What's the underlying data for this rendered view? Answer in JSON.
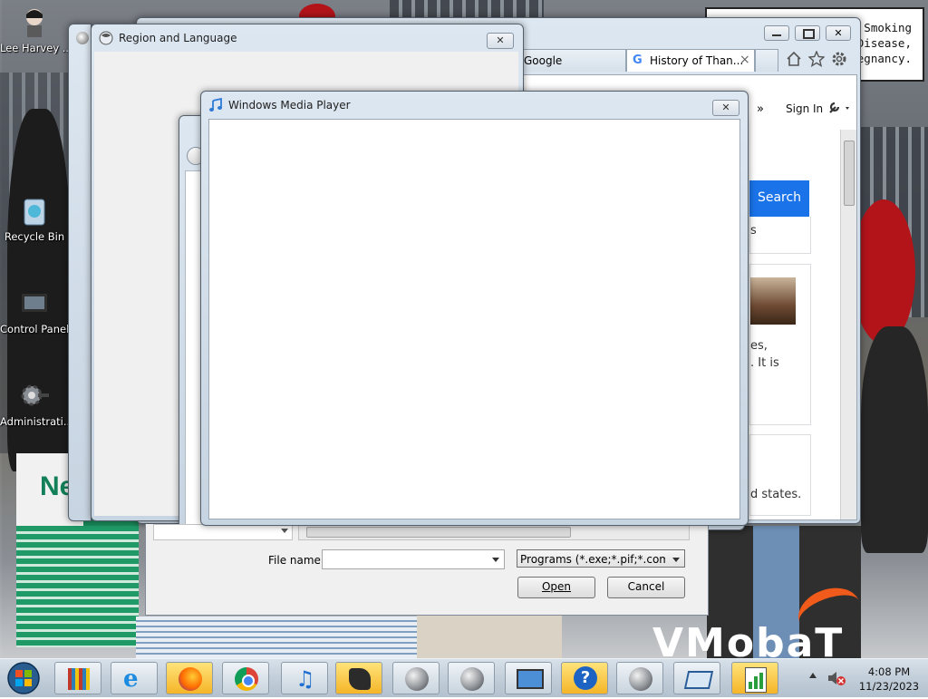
{
  "desktop": {
    "icons": [
      {
        "label": "Lee Harvey ...",
        "icon": "person-icon"
      },
      {
        "label": "Recycle Bin",
        "icon": "recycle-bin-icon"
      },
      {
        "label": "Control Panel",
        "icon": "control-panel-icon"
      },
      {
        "label": "Administrati...",
        "icon": "admin-tools-icon"
      }
    ],
    "billboard": {
      "line1": "s: Smoking",
      "line2": "Disease,",
      "line3": "Pregnancy."
    },
    "wallpaper_text": "VMobaT",
    "box_text": "Ne"
  },
  "browser": {
    "tabs": [
      {
        "label": "Google"
      },
      {
        "label": "History of Than..."
      }
    ],
    "tab_close": "×",
    "more": "»",
    "sign_in": "Sign In",
    "search_button": "Search",
    "snippet_fragments": [
      "s",
      "es,",
      ". It is",
      "d states."
    ]
  },
  "region_dialog": {
    "title": "Region and Language",
    "close": "✕"
  },
  "wmp": {
    "title": "Windows Media Player",
    "close": "✕"
  },
  "open_dialog": {
    "file_name_label": "File name:",
    "file_name_value": "",
    "file_type_value": "Programs (*.exe;*.pif;*.com;*.ba",
    "open_button": "Open",
    "cancel_button": "Cancel"
  },
  "taskbar": {
    "buttons": [
      {
        "name": "library-button",
        "icon": "library-icon"
      },
      {
        "name": "internet-explorer-button",
        "icon": "internet-explorer-icon"
      },
      {
        "name": "firefox-button",
        "icon": "firefox-icon"
      },
      {
        "name": "chrome-button",
        "icon": "chrome-icon"
      },
      {
        "name": "itunes-button",
        "icon": "music-note-icon"
      },
      {
        "name": "paint-button",
        "icon": "paint-icon"
      },
      {
        "name": "app-button-1",
        "icon": "globe-icon"
      },
      {
        "name": "app-button-2",
        "icon": "globe-icon"
      },
      {
        "name": "remote-desktop-button",
        "icon": "monitor-icon"
      },
      {
        "name": "help-button",
        "icon": "help-icon"
      },
      {
        "name": "app-button-3",
        "icon": "globe-icon"
      },
      {
        "name": "window-button",
        "icon": "window-icon"
      },
      {
        "name": "chart-app-button",
        "icon": "chart-icon"
      }
    ],
    "time": "4:08 PM",
    "date": "11/23/2023"
  }
}
